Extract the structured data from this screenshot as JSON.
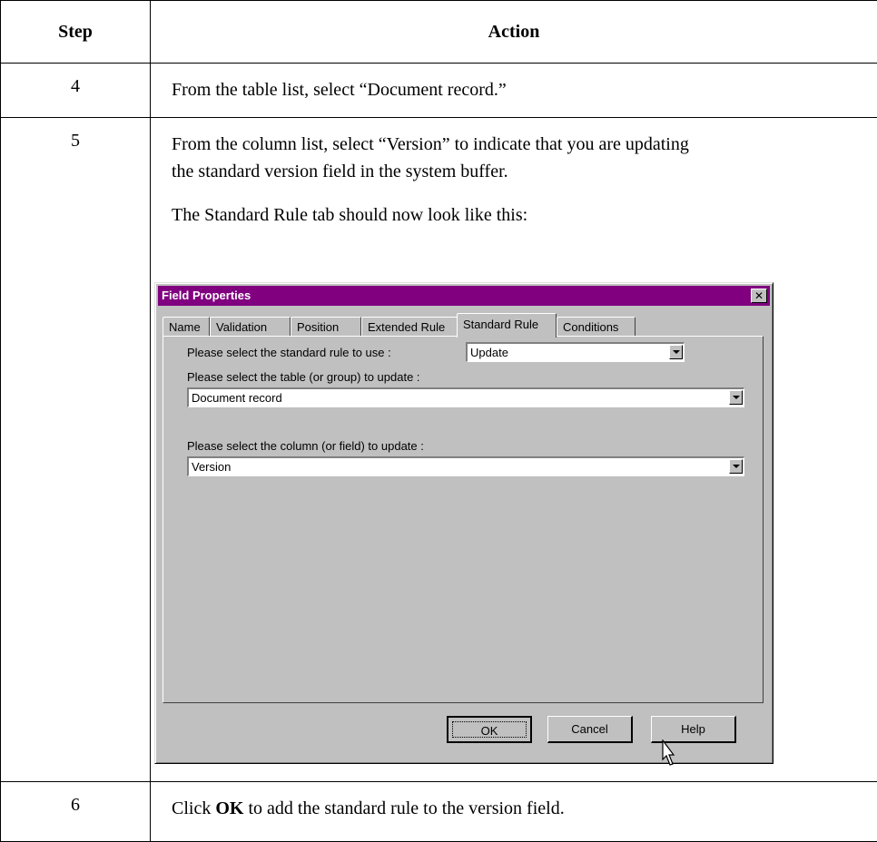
{
  "table": {
    "header_step": "Step",
    "header_action": "Action",
    "rows": [
      {
        "step": "4",
        "action": "From the table list, select “Document record.”"
      },
      {
        "step": "5",
        "action_line1": "From the column list, select “Version” to indicate that you are updating",
        "action_line2": "the standard version field in the system buffer.",
        "action_line3": "The Standard Rule tab should now look like this:"
      },
      {
        "step": "6",
        "action_pre": "Click ",
        "action_bold": "OK",
        "action_post": " to add the standard rule to the version field."
      }
    ]
  },
  "dialog": {
    "title": "Field Properties",
    "close": "✕",
    "title_color": "#800080",
    "tabs": [
      "Name",
      "Validation",
      "Position",
      "Extended Rule",
      "Standard Rule",
      "Conditions"
    ],
    "active_tab": "Standard Rule",
    "rule_label": "Please select the standard rule to use :",
    "rule_value": "Update",
    "table_label": "Please select the table (or group) to update :",
    "table_value": "Document record",
    "column_label": "Please select the column (or field) to update :",
    "column_value": "Version",
    "buttons": {
      "ok": "OK",
      "cancel": "Cancel",
      "help": "Help"
    }
  }
}
